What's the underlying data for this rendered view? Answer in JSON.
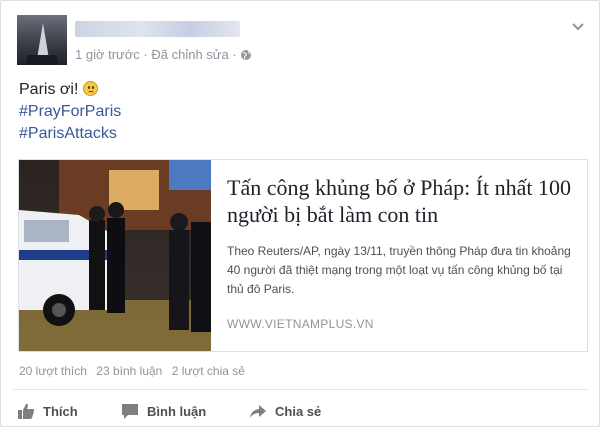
{
  "post": {
    "time": "1 giờ trước",
    "separator": "·",
    "edited": "Đã chỉnh sửa",
    "separator2": "·",
    "globe_icon": "globe-icon",
    "text": "Paris ơi!",
    "emoji": "frowning-face",
    "hashtags": [
      "#PrayForParis",
      "#ParisAttacks"
    ]
  },
  "share": {
    "title": "Tấn công khủng bố ở Pháp: Ít nhất 100 người bị bắt làm con tin",
    "description": "Theo Reuters/AP, ngày 13/11, truyền thông Pháp đưa tin khoảng 40 người đã thiệt mạng trong một loạt vụ tấn công khủng bố tại thủ đô Paris.",
    "domain": "WWW.VIETNAMPLUS.VN"
  },
  "stats": {
    "likes": "20 lượt thích",
    "comments": "23 bình luận",
    "shares": "2 lượt chia sẻ"
  },
  "actions": {
    "like": "Thích",
    "comment": "Bình luận",
    "share": "Chia sẻ"
  },
  "colors": {
    "link": "#365899",
    "muted": "#90949c",
    "action": "#4b4f56"
  }
}
